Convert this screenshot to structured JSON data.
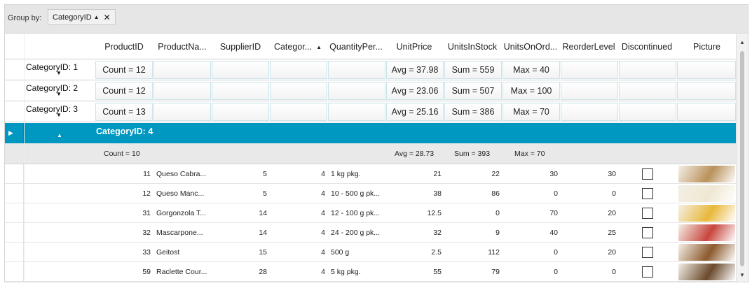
{
  "group_panel": {
    "label": "Group by:",
    "chip_text": "CategoryID",
    "chip_sort_icon": "sort-ascending-icon",
    "chip_close_icon": "close-icon"
  },
  "columns": [
    "ProductID",
    "ProductNa...",
    "SupplierID",
    "Categor...",
    "QuantityPer...",
    "UnitPrice",
    "UnitsInStock",
    "UnitsOnOrd...",
    "ReorderLevel",
    "Discontinued",
    "Picture"
  ],
  "collapsed_groups": [
    {
      "title": "CategoryID: 1",
      "count": "Count = 12",
      "avg": "Avg = 37.98",
      "sum": "Sum = 559",
      "max": "Max = 40"
    },
    {
      "title": "CategoryID: 2",
      "count": "Count = 12",
      "avg": "Avg = 23.06",
      "sum": "Sum = 507",
      "max": "Max = 100"
    },
    {
      "title": "CategoryID: 3",
      "count": "Count = 13",
      "avg": "Avg = 25.16",
      "sum": "Sum = 386",
      "max": "Max = 70"
    }
  ],
  "expanded_group": {
    "title": "CategoryID: 4",
    "count": "Count = 10",
    "avg": "Avg = 28.73",
    "sum": "Sum = 393",
    "max": "Max = 70"
  },
  "rows": [
    {
      "id": "11",
      "name": "Queso Cabra...",
      "supplier": "5",
      "category": "4",
      "qty": "1 kg pkg.",
      "price": "21",
      "stock": "22",
      "order": "30",
      "reorder": "30",
      "discontinued": false,
      "picture_color": "#b9915a"
    },
    {
      "id": "12",
      "name": "Queso Manc...",
      "supplier": "5",
      "category": "4",
      "qty": "10 - 500 g pk...",
      "price": "38",
      "stock": "86",
      "order": "0",
      "reorder": "0",
      "discontinued": false,
      "picture_color": "#eee8d2"
    },
    {
      "id": "31",
      "name": "Gorgonzola T...",
      "supplier": "14",
      "category": "4",
      "qty": "12 - 100 g pk...",
      "price": "12.5",
      "stock": "0",
      "order": "70",
      "reorder": "20",
      "discontinued": false,
      "picture_color": "#e8b83a"
    },
    {
      "id": "32",
      "name": "Mascarpone...",
      "supplier": "14",
      "category": "4",
      "qty": "24 - 200 g pk...",
      "price": "32",
      "stock": "9",
      "order": "40",
      "reorder": "25",
      "discontinued": false,
      "picture_color": "#c8463e"
    },
    {
      "id": "33",
      "name": "Geitost",
      "supplier": "15",
      "category": "4",
      "qty": "500 g",
      "price": "2.5",
      "stock": "112",
      "order": "0",
      "reorder": "20",
      "discontinued": false,
      "picture_color": "#8c5a2e"
    },
    {
      "id": "59",
      "name": "Raclette Cour...",
      "supplier": "28",
      "category": "4",
      "qty": "5 kg pkg.",
      "price": "55",
      "stock": "79",
      "order": "0",
      "reorder": "0",
      "discontinued": false,
      "picture_color": "#6a4a2c"
    }
  ],
  "colors": {
    "accent": "#0097c1",
    "footer_bg": "#e9e9e9",
    "panel_bg": "#e6e6e6"
  }
}
